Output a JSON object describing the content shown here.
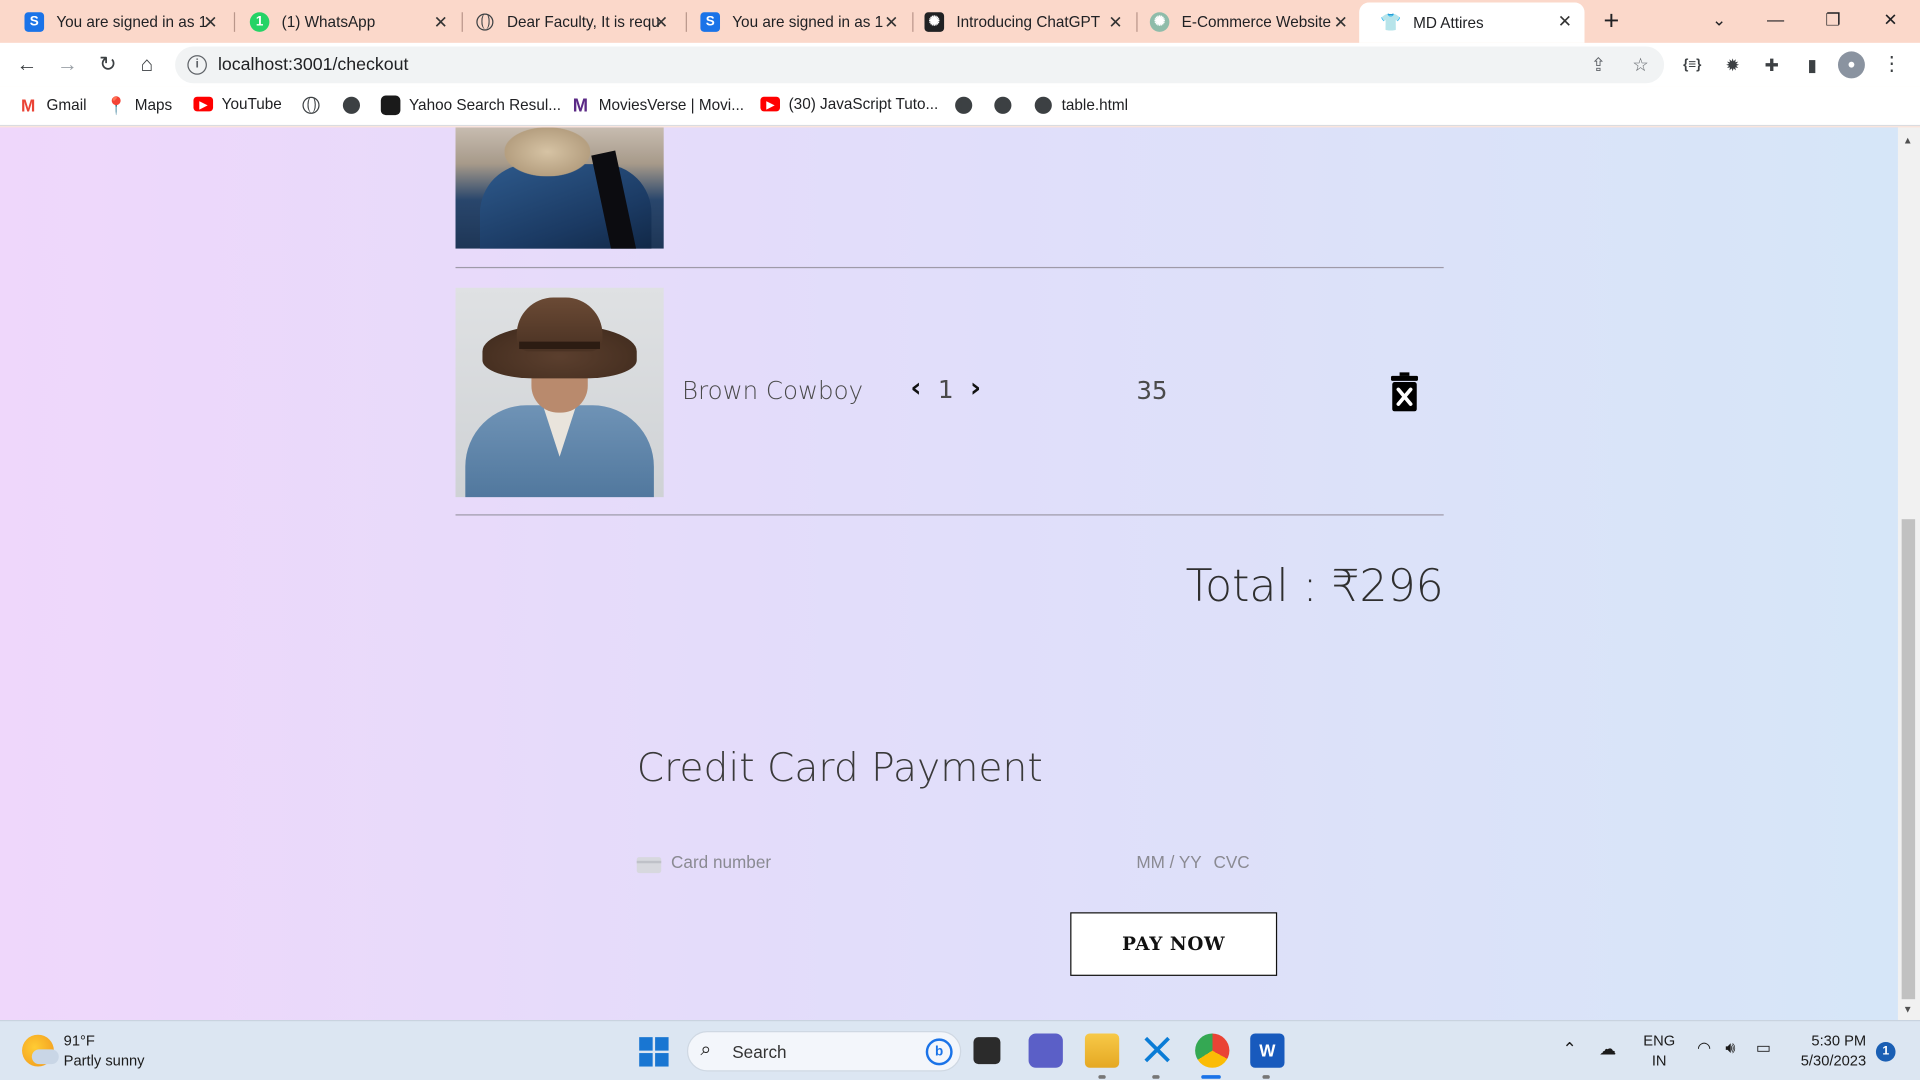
{
  "browser": {
    "tabs": [
      {
        "title": "You are signed in as 1",
        "favicon": "s-icon"
      },
      {
        "title": "(1) WhatsApp",
        "favicon": "whatsapp-icon"
      },
      {
        "title": "Dear Faculty, It is requ",
        "favicon": "globe-icon"
      },
      {
        "title": "You are signed in as 1",
        "favicon": "s-icon"
      },
      {
        "title": "Introducing ChatGPT",
        "favicon": "openai-icon"
      },
      {
        "title": "E-Commerce Website",
        "favicon": "chatgpt-icon"
      },
      {
        "title": "MD Attires",
        "favicon": "shirt-icon",
        "active": true
      }
    ],
    "address": "localhost:3001/checkout",
    "bookmarks": [
      {
        "label": "Gmail",
        "icon": "gmail-icon"
      },
      {
        "label": "Maps",
        "icon": "maps-icon"
      },
      {
        "label": "YouTube",
        "icon": "youtube-icon"
      },
      {
        "label": "",
        "icon": "globe-icon"
      },
      {
        "label": "",
        "icon": "globe-icon"
      },
      {
        "label": "Yahoo Search Resul...",
        "icon": "yahoo-icon"
      },
      {
        "label": "MoviesVerse | Movi...",
        "icon": "moviesverse-icon"
      },
      {
        "label": "(30) JavaScript Tuto...",
        "icon": "youtube-icon"
      },
      {
        "label": "",
        "icon": "globe-icon"
      },
      {
        "label": "",
        "icon": "globe-icon"
      },
      {
        "label": "table.html",
        "icon": "globe-icon"
      }
    ]
  },
  "cart": {
    "items": [
      {
        "name": "",
        "image": "denim-jacket-fur-collar"
      },
      {
        "name": "Brown Cowboy",
        "quantity": "1",
        "price": "35",
        "image": "brown-cowboy-hat"
      }
    ],
    "total_label": "Total : ₹296"
  },
  "payment": {
    "title": "Credit Card Payment",
    "card_placeholder": "Card number",
    "expiry_placeholder": "MM / YY",
    "cvc_placeholder": "CVC",
    "pay_button": "PAY NOW"
  },
  "taskbar": {
    "weather_temp": "91°F",
    "weather_desc": "Partly sunny",
    "search_label": "Search",
    "lang_line1": "ENG",
    "lang_line2": "IN",
    "time": "5:30 PM",
    "date": "5/30/2023",
    "notification_count": "1"
  },
  "colors": {
    "tabstrip": "#fbd8ca",
    "page_gradient_start": "#efd7fb",
    "page_gradient_end": "#d6e6f8"
  }
}
